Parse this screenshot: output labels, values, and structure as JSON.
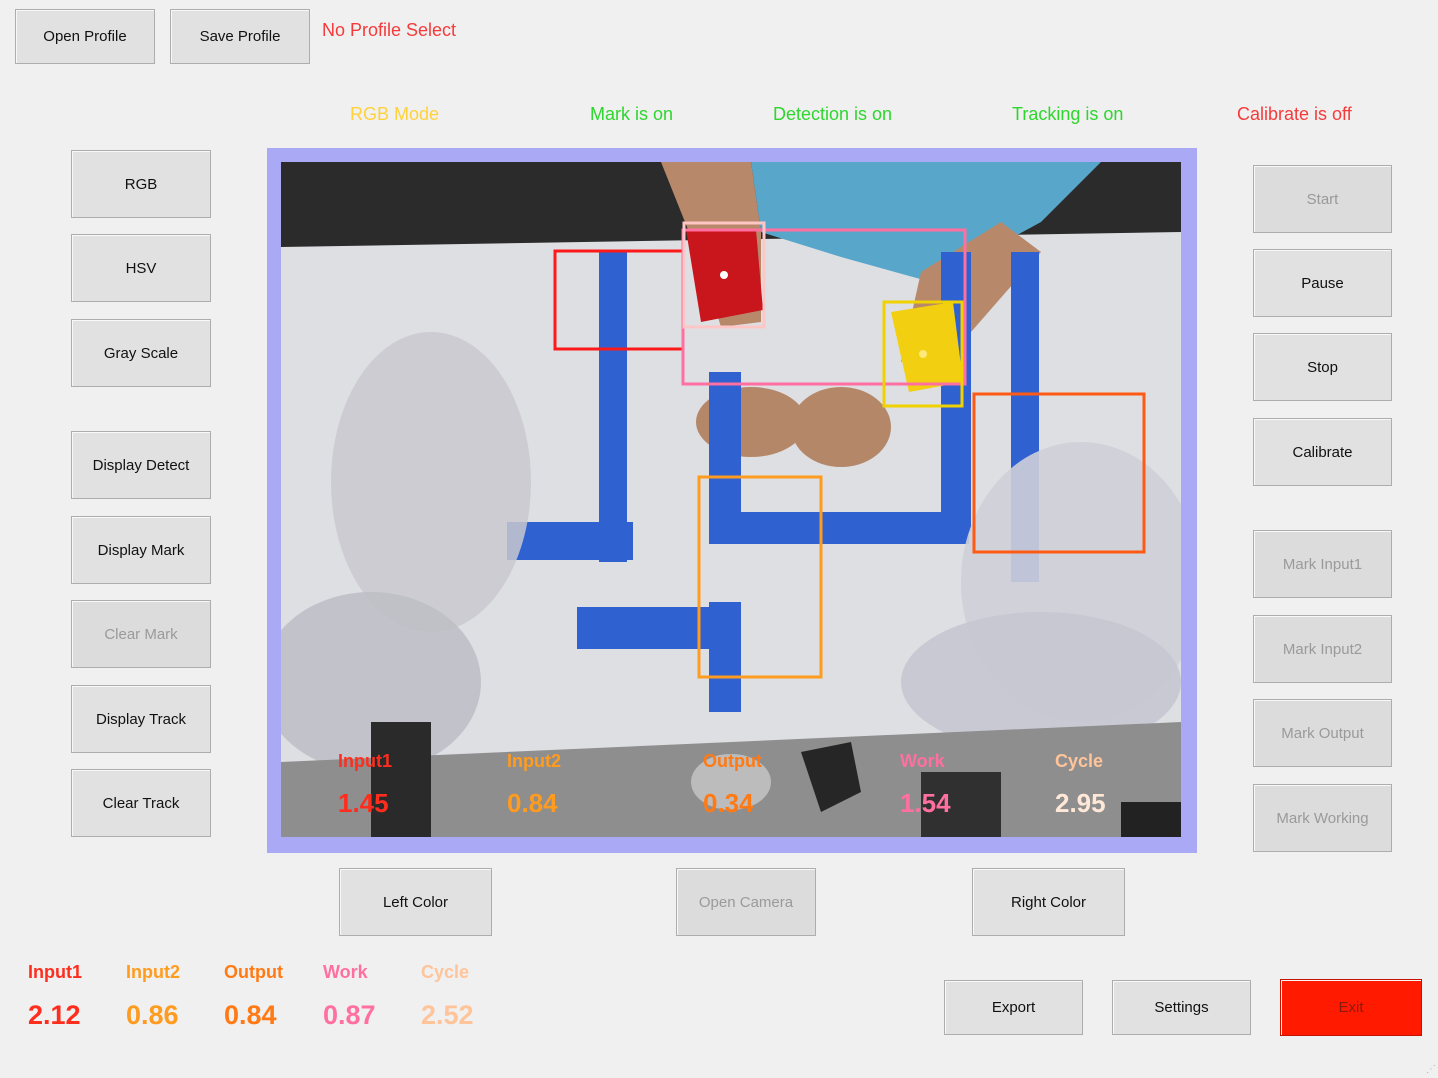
{
  "top": {
    "open_profile": "Open Profile",
    "save_profile": "Save Profile",
    "profile_status": "No Profile Select"
  },
  "status_bar": {
    "mode": "RGB Mode",
    "mark": "Mark is on",
    "detection": "Detection is on",
    "tracking": "Tracking is on",
    "calibrate": "Calibrate is off"
  },
  "colors": {
    "mode": "#ffd23c",
    "on": "#2ed62e",
    "off": "#f53a3a",
    "input1": "#ff2d1e",
    "input2": "#ff9b1e",
    "output": "#ff7a14",
    "work": "#ff6fa0",
    "cycle": "#ffc49a",
    "frame": "#a9a9f5"
  },
  "left_buttons": {
    "rgb": "RGB",
    "hsv": "HSV",
    "gray": "Gray Scale",
    "display_detect": "Display Detect",
    "display_mark": "Display Mark",
    "clear_mark": "Clear Mark",
    "display_track": "Display Track",
    "clear_track": "Clear Track"
  },
  "right_buttons": {
    "start": "Start",
    "pause": "Pause",
    "stop": "Stop",
    "calibrate": "Calibrate",
    "mark_input1": "Mark Input1",
    "mark_input2": "Mark Input2",
    "mark_output": "Mark Output",
    "mark_working": "Mark Working"
  },
  "camera_buttons": {
    "left_color": "Left Color",
    "open_camera": "Open Camera",
    "right_color": "Right Color"
  },
  "overlay": {
    "input1": {
      "label": "Input1",
      "value": "1.45"
    },
    "input2": {
      "label": "Input2",
      "value": "0.84"
    },
    "output": {
      "label": "Output",
      "value": "0.34"
    },
    "work": {
      "label": "Work",
      "value": "1.54"
    },
    "cycle": {
      "label": "Cycle",
      "value": "2.95"
    }
  },
  "bottom_stats": {
    "input1": {
      "label": "Input1",
      "value": "2.12"
    },
    "input2": {
      "label": "Input2",
      "value": "0.86"
    },
    "output": {
      "label": "Output",
      "value": "0.84"
    },
    "work": {
      "label": "Work",
      "value": "0.87"
    },
    "cycle": {
      "label": "Cycle",
      "value": "2.52"
    }
  },
  "bottom_buttons": {
    "export": "Export",
    "settings": "Settings",
    "exit": "Exit"
  }
}
